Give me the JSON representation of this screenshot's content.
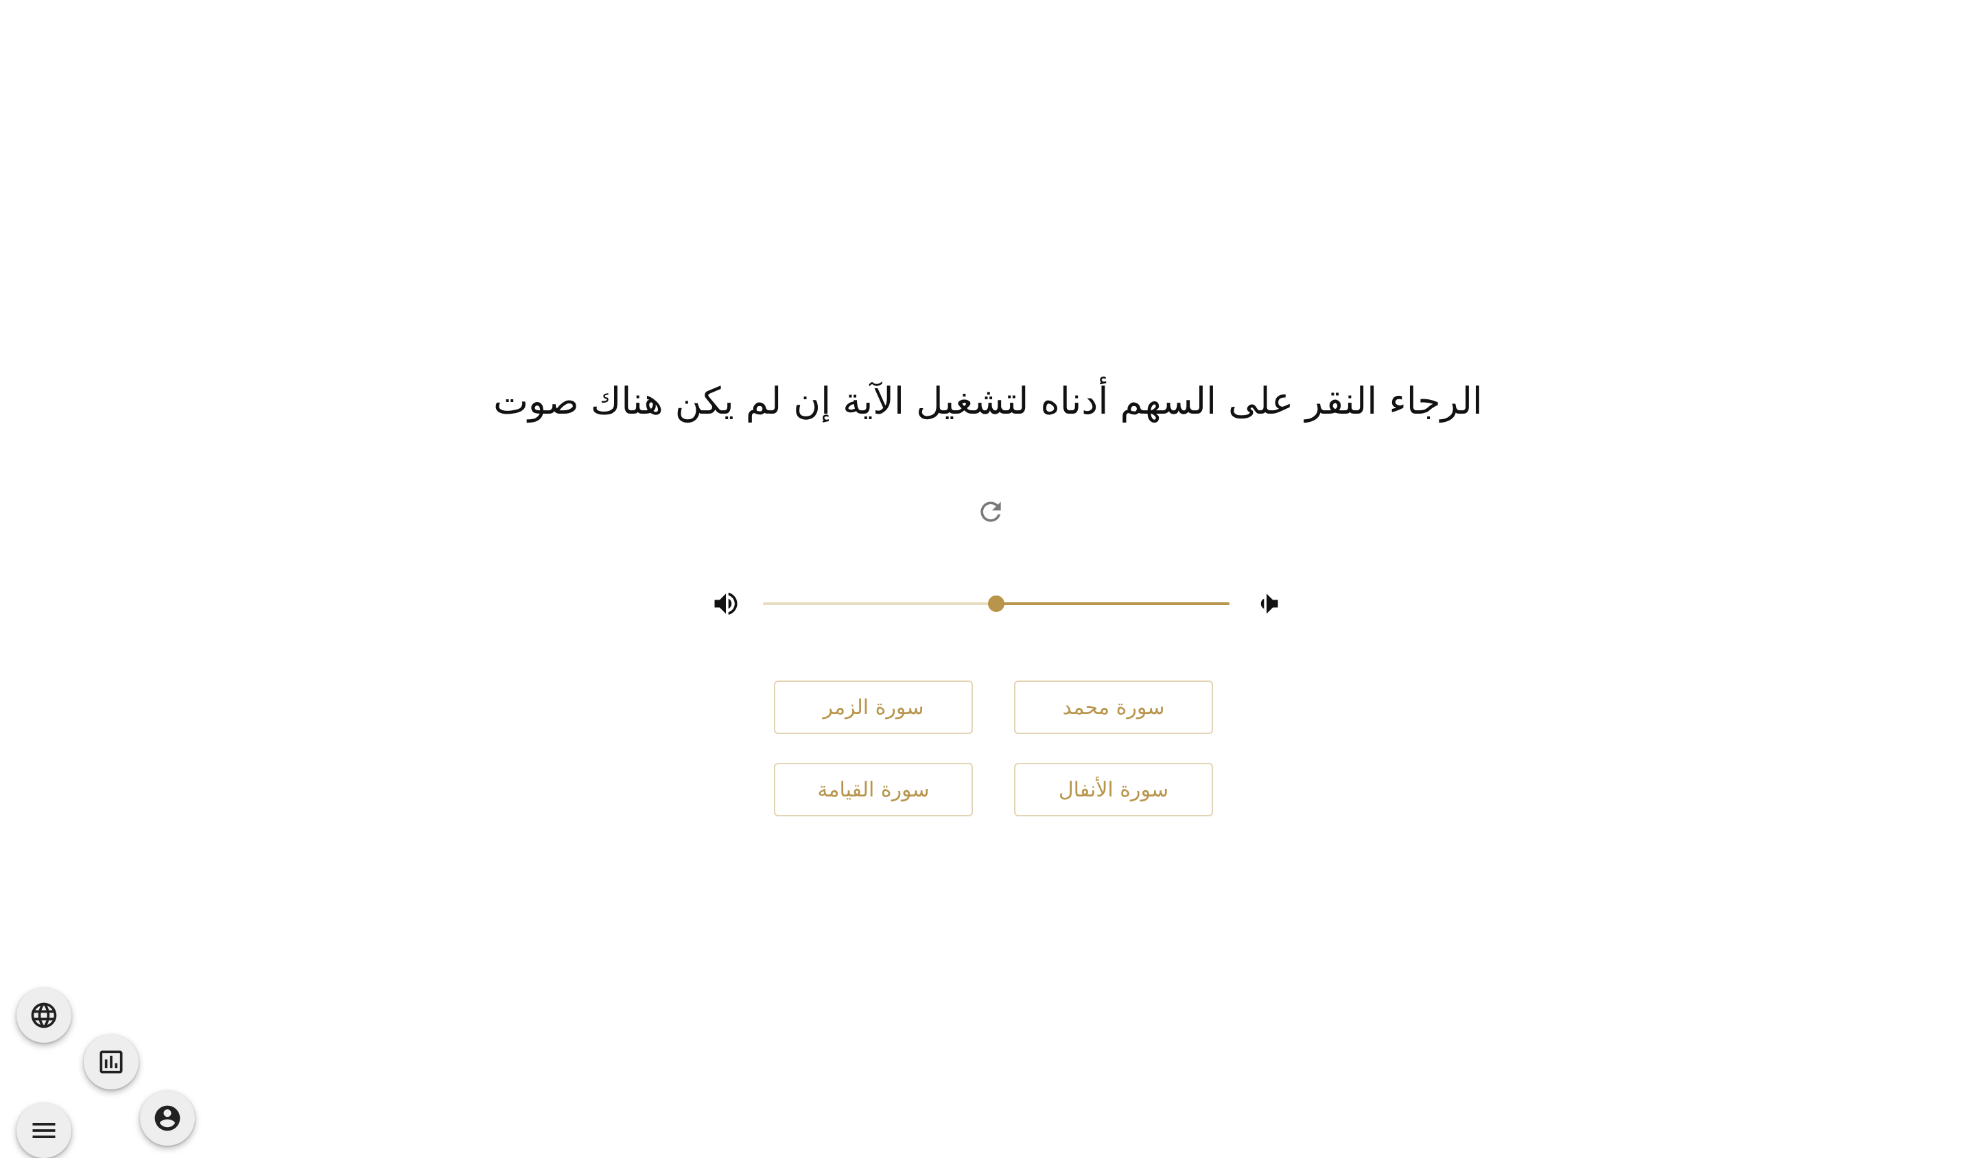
{
  "prompt": {
    "instruction": "الرجاء النقر على السهم أدناه لتشغيل الآية إن لم يكن هناك صوت"
  },
  "player": {
    "replay_icon": "replay-icon",
    "volume_up_icon": "volume-up-icon",
    "volume_down_icon": "volume-down-icon",
    "volume_level": 0.5,
    "accent_color": "#b8954b",
    "track_color": "#e8dcc0"
  },
  "answers": [
    {
      "label": "سورة محمد"
    },
    {
      "label": "سورة الزمر"
    },
    {
      "label": "سورة الأنفال"
    },
    {
      "label": "سورة القيامة"
    }
  ],
  "fabs": {
    "language_icon": "globe-icon",
    "stats_icon": "bar-chart-icon",
    "menu_icon": "menu-icon",
    "account_icon": "account-circle-icon"
  }
}
